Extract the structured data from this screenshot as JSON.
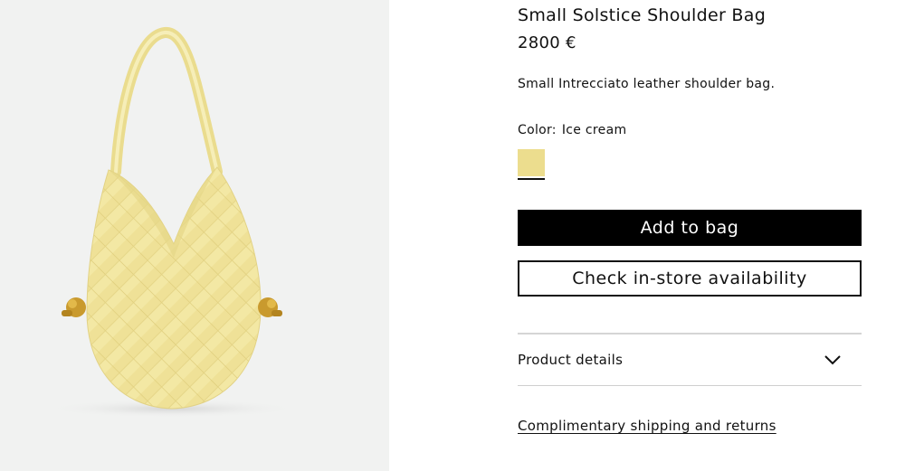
{
  "product": {
    "title": "Small Solstice Shoulder Bag",
    "price": "2800 €",
    "description": "Small Intrecciato leather shoulder bag.",
    "color_label": "Color:",
    "color_value": "Ice cream",
    "swatch_color": "#ecdd8e",
    "image_icon": "woven-shoulder-bag-image"
  },
  "actions": {
    "add_to_bag": "Add to bag",
    "check_store": "Check in-store availability"
  },
  "details": {
    "label": "Product details",
    "icon": "chevron-down-icon"
  },
  "shipping": {
    "link_text": "Complimentary shipping and returns"
  }
}
